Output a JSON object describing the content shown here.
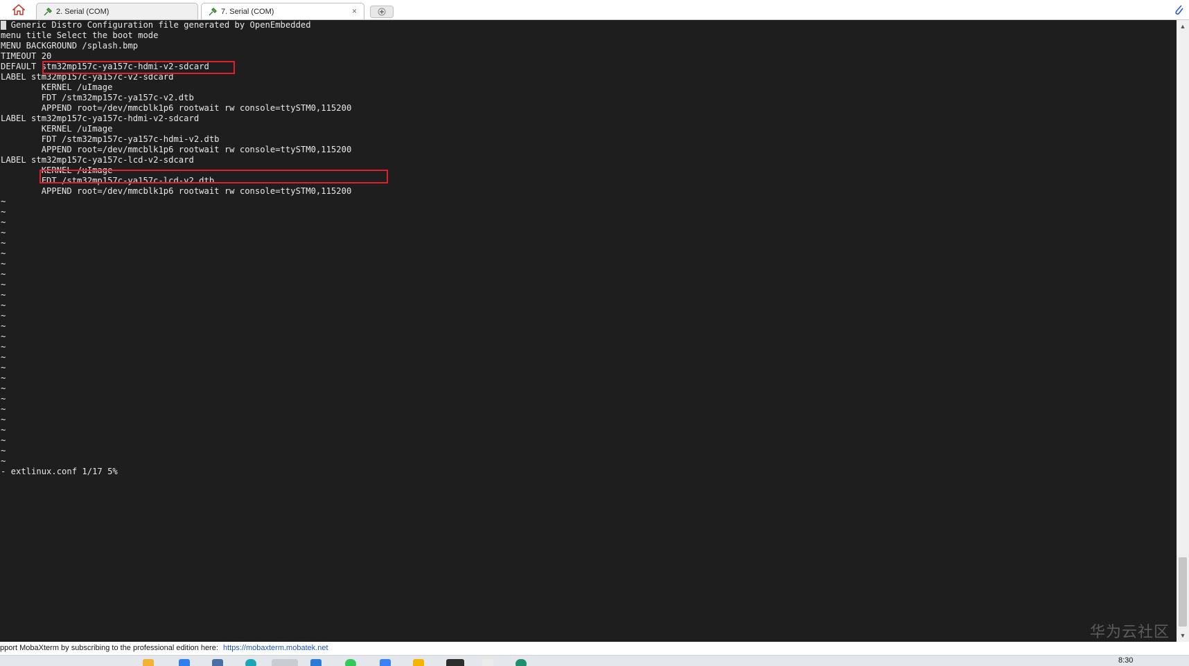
{
  "window": {
    "tabs": [
      {
        "label": "2. Serial (COM)",
        "active": false
      },
      {
        "label": "7. Serial (COM)",
        "active": true
      }
    ],
    "close_glyph": "×",
    "new_tab_glyph": "+"
  },
  "terminal": {
    "lines": [
      "  Generic Distro Configuration file generated by OpenEmbedded",
      "menu title Select the boot mode",
      "MENU BACKGROUND /splash.bmp",
      "TIMEOUT 20",
      "DEFAULT stm32mp157c-ya157c-hdmi-v2-sdcard",
      "LABEL stm32mp157c-ya157c-v2-sdcard",
      "        KERNEL /uImage",
      "        FDT /stm32mp157c-ya157c-v2.dtb",
      "        APPEND root=/dev/mmcblk1p6 rootwait rw console=ttySTM0,115200",
      "LABEL stm32mp157c-ya157c-hdmi-v2-sdcard",
      "        KERNEL /uImage",
      "        FDT /stm32mp157c-ya157c-hdmi-v2.dtb",
      "        APPEND root=/dev/mmcblk1p6 rootwait rw console=ttySTM0,115200",
      "LABEL stm32mp157c-ya157c-lcd-v2-sdcard",
      "        KERNEL /uImage",
      "        FDT /stm32mp157c-ya157c-lcd-v2.dtb",
      "        APPEND root=/dev/mmcblk1p6 rootwait rw console=ttySTM0,115200",
      "~",
      "~",
      "~",
      "~",
      "~",
      "~",
      "~",
      "~",
      "~",
      "~",
      "~",
      "~",
      "~",
      "~",
      "~",
      "~",
      "~",
      "~",
      "~",
      "~",
      "~",
      "~",
      "~",
      "~",
      "~",
      "~",
      "- extlinux.conf 1/17 5%"
    ],
    "watermark": "华为云社区"
  },
  "statusbar": {
    "text": "pport MobaXterm by subscribing to the professional edition here:",
    "link": "https://mobaxterm.mobatek.net"
  },
  "taskbar": {
    "time": "8:30"
  },
  "colors": {
    "terminal_bg": "#1e1e1e",
    "terminal_fg": "#e8e8e8",
    "highlight": "#e0202a",
    "link": "#1a4fd1"
  }
}
